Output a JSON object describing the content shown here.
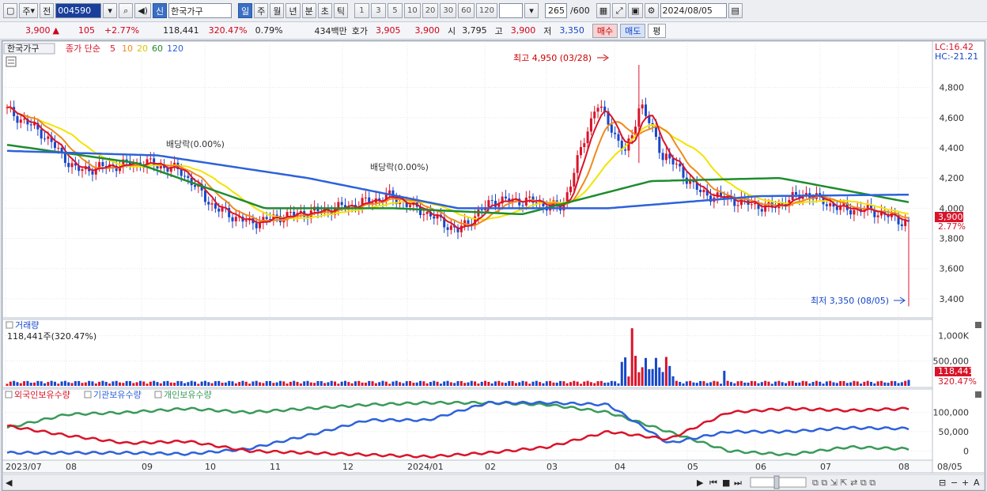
{
  "toolbar": {
    "market_select": "주",
    "prev_label": "전",
    "stock_code": "004590",
    "search_icon": "magnifier-icon",
    "sound_icon": "speaker-icon",
    "badge_new": "신",
    "stock_name": "한국가구",
    "periods": [
      "일",
      "주",
      "월",
      "년",
      "분",
      "초",
      "틱"
    ],
    "active_period": "일",
    "intervals": [
      "1",
      "3",
      "5",
      "10",
      "20",
      "30",
      "60",
      "120"
    ],
    "count_value": "265",
    "count_total": "/600",
    "date_value": "2024/08/05"
  },
  "quote": {
    "price": "3,900",
    "arrow": "▲",
    "change": "105",
    "change_pct": "+2.77%",
    "volume": "118,441",
    "volume_pct": "320.47%",
    "turnover": "0.79%",
    "amount": "434백만",
    "label_quote": "호가",
    "ask": "3,905",
    "bid": "3,900",
    "label_open": "시",
    "open": "3,795",
    "label_high": "고",
    "high": "3,900",
    "label_low": "저",
    "low": "3,350",
    "buy_label": "매수",
    "sell_label": "매도",
    "flat_label": "평"
  },
  "price_panel": {
    "title_stock": "한국가구",
    "ma_label": "종가 단순",
    "ma_periods": [
      "5",
      "10",
      "20",
      "60",
      "120"
    ],
    "lc_label": "LC:16.42",
    "hc_label": "HC:-21.21",
    "y_ticks": [
      "4,800",
      "4,600",
      "4,400",
      "4,200",
      "4,000",
      "3,800",
      "3,600",
      "3,400"
    ],
    "last_price_tag": "3,900",
    "last_pct_tag": "2.77%",
    "high_annotation": "최고 4,950 (03/28)",
    "low_annotation": "최저 3,350 (08/05)",
    "dividend_labels": [
      "배당락(0.00%)",
      "배당락(0.00%)"
    ]
  },
  "volume_panel": {
    "title": "거래량",
    "value_text": "118,441주(320.47%)",
    "y_ticks": [
      "1,000K",
      "500,000"
    ],
    "last_tag": "118,441",
    "last_pct_tag": "320.47%"
  },
  "holdings_panel": {
    "series_labels": [
      "외국인보유수량",
      "기관보유수량",
      "개인보유수량"
    ],
    "y_ticks": [
      "100,000",
      "50,000",
      "0"
    ]
  },
  "x_axis": {
    "labels": [
      "2023/07",
      "08",
      "09",
      "10",
      "11",
      "12",
      "2024/01",
      "02",
      "03",
      "04",
      "05",
      "06",
      "07",
      "08",
      "08/05"
    ]
  },
  "colors": {
    "ma5": "#d9142a",
    "ma10": "#ef8a1c",
    "ma20": "#f2e400",
    "ma60": "#1e8c2e",
    "ma120": "#2d62d9",
    "up": "#d9142a",
    "down": "#1747c9",
    "foreign": "#d9142a",
    "institution": "#2d62d9",
    "individual": "#3a9a5a"
  },
  "chart_data": {
    "type": "candlestick",
    "price_ylim": [
      3300,
      4950
    ],
    "volume_ylim": [
      0,
      1200000
    ],
    "holdings_ylim": [
      -20000,
      130000
    ],
    "x_axis": "daily, 2023/07 – 2024/08/05",
    "highest": {
      "value": 4950,
      "date": "03/28"
    },
    "lowest": {
      "value": 3350,
      "date": "08/05"
    },
    "close_points": [
      [
        "2023/07",
        4650
      ],
      [
        "07 mid",
        4500
      ],
      [
        "08",
        4250
      ],
      [
        "08 mid",
        4280
      ],
      [
        "09",
        4300
      ],
      [
        "09 mid",
        4250
      ],
      [
        "10",
        4000
      ],
      [
        "10 mid",
        3900
      ],
      [
        "11",
        3950
      ],
      [
        "11 mid",
        3980
      ],
      [
        "12",
        4020
      ],
      [
        "12 mid",
        4080
      ],
      [
        "2024/01",
        3980
      ],
      [
        "01 mid",
        3850
      ],
      [
        "02",
        4050
      ],
      [
        "02 mid",
        4050
      ],
      [
        "03",
        4000
      ],
      [
        "03 late",
        4700
      ],
      [
        "04",
        4300
      ],
      [
        "04 mid",
        4350
      ],
      [
        "05",
        4100
      ],
      [
        "05 mid",
        4050
      ],
      [
        "06",
        4000
      ],
      [
        "06 mid",
        4100
      ],
      [
        "07",
        4000
      ],
      [
        "07 mid",
        3980
      ],
      [
        "08/05",
        3900
      ]
    ],
    "ma120_points": [
      [
        "2023/07",
        4380
      ],
      [
        "09",
        4350
      ],
      [
        "12",
        4200
      ],
      [
        "02",
        4000
      ],
      [
        "04",
        4000
      ],
      [
        "06",
        4080
      ],
      [
        "08/05",
        4090
      ]
    ],
    "ma60_points": [
      [
        "2023/07",
        4420
      ],
      [
        "09",
        4300
      ],
      [
        "11",
        4000
      ],
      [
        "01",
        4000
      ],
      [
        "03",
        3960
      ],
      [
        "05",
        4180
      ],
      [
        "06",
        4200
      ],
      [
        "08/05",
        4040
      ]
    ]
  }
}
